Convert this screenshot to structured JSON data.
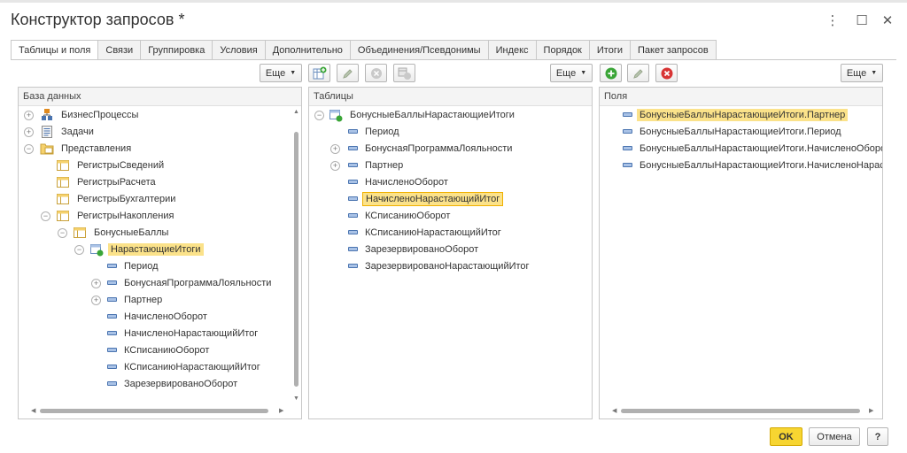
{
  "window": {
    "title": "Конструктор запросов *",
    "more_icon": "⋮",
    "maximize_icon": "☐",
    "close_icon": "✕"
  },
  "tabs": [
    {
      "label": "Таблицы и поля",
      "active": true
    },
    {
      "label": "Связи"
    },
    {
      "label": "Группировка"
    },
    {
      "label": "Условия"
    },
    {
      "label": "Дополнительно"
    },
    {
      "label": "Объединения/Псевдонимы"
    },
    {
      "label": "Индекс"
    },
    {
      "label": "Порядок"
    },
    {
      "label": "Итоги"
    },
    {
      "label": "Пакет запросов"
    }
  ],
  "toolbar": {
    "more_label": "Еще"
  },
  "database_panel": {
    "header": "База данных",
    "items": [
      {
        "label": "БизнесПроцессы",
        "icon": "business-process-icon",
        "expander": "+"
      },
      {
        "label": "Задачи",
        "icon": "task-list-icon",
        "expander": "+"
      },
      {
        "label": "Представления",
        "icon": "folder-icon",
        "expander": "−"
      },
      {
        "label": "РегистрыСведений",
        "icon": "register-icon"
      },
      {
        "label": "РегистрыРасчета",
        "icon": "register-icon"
      },
      {
        "label": "РегистрыБухгалтерии",
        "icon": "register-icon"
      },
      {
        "label": "РегистрыНакопления",
        "icon": "register-icon",
        "expander": "−"
      },
      {
        "label": "БонусныеБаллы",
        "icon": "register-icon",
        "expander": "−"
      },
      {
        "label": "НарастающиеИтоги",
        "icon": "virtual-table-icon",
        "expander": "−",
        "selected": true
      },
      {
        "label": "Период",
        "icon": "field-icon"
      },
      {
        "label": "БонуснаяПрограммаЛояльности",
        "icon": "field-icon",
        "expander": "+"
      },
      {
        "label": "Партнер",
        "icon": "field-icon",
        "expander": "+"
      },
      {
        "label": "НачисленоОборот",
        "icon": "field-icon"
      },
      {
        "label": "НачисленоНарастающийИтог",
        "icon": "field-icon"
      },
      {
        "label": "КСписаниюОборот",
        "icon": "field-icon"
      },
      {
        "label": "КСписаниюНарастающийИтог",
        "icon": "field-icon"
      },
      {
        "label": "ЗарезервированоОборот",
        "icon": "field-icon"
      }
    ]
  },
  "tables_panel": {
    "header": "Таблицы",
    "items": [
      {
        "label": "БонусныеБаллыНарастающиеИтоги",
        "icon": "virtual-table-icon",
        "expander": "−"
      },
      {
        "label": "Период",
        "icon": "field-icon"
      },
      {
        "label": "БонуснаяПрограммаЛояльности",
        "icon": "field-icon",
        "expander": "+"
      },
      {
        "label": "Партнер",
        "icon": "field-icon",
        "expander": "+"
      },
      {
        "label": "НачисленоОборот",
        "icon": "field-icon"
      },
      {
        "label": "НачисленоНарастающийИтог",
        "icon": "field-icon",
        "selected": true
      },
      {
        "label": "КСписаниюОборот",
        "icon": "field-icon"
      },
      {
        "label": "КСписаниюНарастающийИтог",
        "icon": "field-icon"
      },
      {
        "label": "ЗарезервированоОборот",
        "icon": "field-icon"
      },
      {
        "label": "ЗарезервированоНарастающийИтог",
        "icon": "field-icon"
      }
    ]
  },
  "fields_panel": {
    "header": "Поля",
    "items": [
      {
        "label": "БонусныеБаллыНарастающиеИтоги.Партнер",
        "selected": true
      },
      {
        "label": "БонусныеБаллыНарастающиеИтоги.Период"
      },
      {
        "label": "БонусныеБаллыНарастающиеИтоги.НачисленоОборот"
      },
      {
        "label": "БонусныеБаллыНарастающиеИтоги.НачисленоНарастающийИтог"
      }
    ]
  },
  "footer": {
    "ok_label": "OK",
    "cancel_label": "Отмена",
    "help_label": "?"
  },
  "colors": {
    "selection": "#fbe28a",
    "ok_button": "#f7d531",
    "add_icon": "#3aa537",
    "delete_icon": "#d83434"
  }
}
